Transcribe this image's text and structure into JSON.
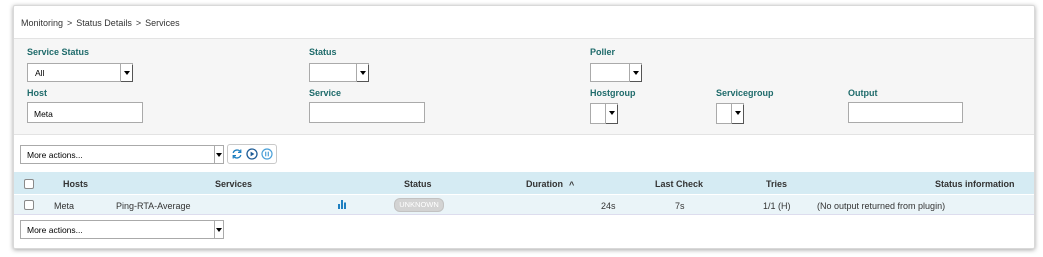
{
  "breadcrumb": [
    "Monitoring",
    ">",
    "Status Details",
    ">",
    "Services"
  ],
  "filters": {
    "service_status": {
      "label": "Service Status",
      "value": "All"
    },
    "status": {
      "label": "Status",
      "value": ""
    },
    "poller": {
      "label": "Poller",
      "value": ""
    },
    "host": {
      "label": "Host",
      "value": "Meta"
    },
    "service": {
      "label": "Service",
      "value": ""
    },
    "hostgroup": {
      "label": "Hostgroup",
      "value": ""
    },
    "servicegroup": {
      "label": "Servicegroup",
      "value": ""
    },
    "output": {
      "label": "Output",
      "value": ""
    }
  },
  "actions": {
    "label": "More actions..."
  },
  "table": {
    "headers": {
      "hosts": "Hosts",
      "services": "Services",
      "status": "Status",
      "duration": "Duration",
      "duration_sort": "^",
      "last_check": "Last Check",
      "tries": "Tries",
      "status_info": "Status information"
    },
    "rows": [
      {
        "host": "Meta",
        "service": "Ping-RTA-Average",
        "status": "UNKNOWN",
        "duration": "24s",
        "last_check": "7s",
        "tries": "1/1 (H)",
        "info": "(No output returned from plugin)"
      }
    ]
  },
  "colors": {
    "label_teal": "#1f6b6b",
    "header_blue": "#d5ebf3",
    "icon_blue": "#1e7fc0",
    "status_unknown": "#d3d3d3"
  },
  "icons": [
    "refresh-icon",
    "play-icon",
    "pause-icon",
    "graph-icon"
  ]
}
